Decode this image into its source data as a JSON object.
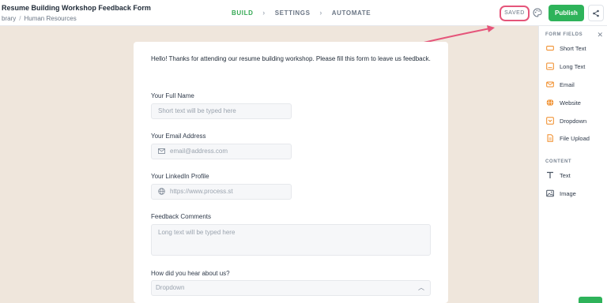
{
  "header": {
    "title": "Resume Building Workshop Feedback Form",
    "breadcrumb": [
      "brary",
      "Human Resources"
    ],
    "steps": [
      "BUILD",
      "SETTINGS",
      "AUTOMATE"
    ],
    "saved_label": "SAVED",
    "publish_label": "Publish"
  },
  "form": {
    "intro": "Hello! Thanks for attending our resume building workshop. Please fill this form to leave us feedback.",
    "fields": [
      {
        "label": "Your Full Name",
        "placeholder": "Short text will be typed here",
        "icon": ""
      },
      {
        "label": "Your Email Address",
        "placeholder": "email@address.com",
        "icon": "mail-icon"
      },
      {
        "label": "Your LinkedIn Profile",
        "placeholder": "https://www.process.st",
        "icon": "globe-icon"
      },
      {
        "label": "Feedback Comments",
        "placeholder": "Long text will be typed here",
        "icon": ""
      }
    ],
    "dropdown": {
      "label": "How did you hear about us?",
      "value": "Dropdown"
    }
  },
  "panel": {
    "form_fields_heading": "FORM FIELDS",
    "form_fields": [
      {
        "label": "Short Text",
        "icon": "short-text-icon"
      },
      {
        "label": "Long Text",
        "icon": "long-text-icon"
      },
      {
        "label": "Email",
        "icon": "email-icon"
      },
      {
        "label": "Website",
        "icon": "website-icon"
      },
      {
        "label": "Dropdown",
        "icon": "dropdown-icon"
      },
      {
        "label": "File Upload",
        "icon": "file-upload-icon"
      }
    ],
    "content_heading": "CONTENT",
    "content_items": [
      {
        "label": "Text",
        "icon": "text-icon"
      },
      {
        "label": "Image",
        "icon": "image-icon"
      }
    ]
  },
  "colors": {
    "accent_green": "#2eb35a",
    "field_icon_orange": "#f08a24",
    "highlight_pink": "#e5557a"
  }
}
